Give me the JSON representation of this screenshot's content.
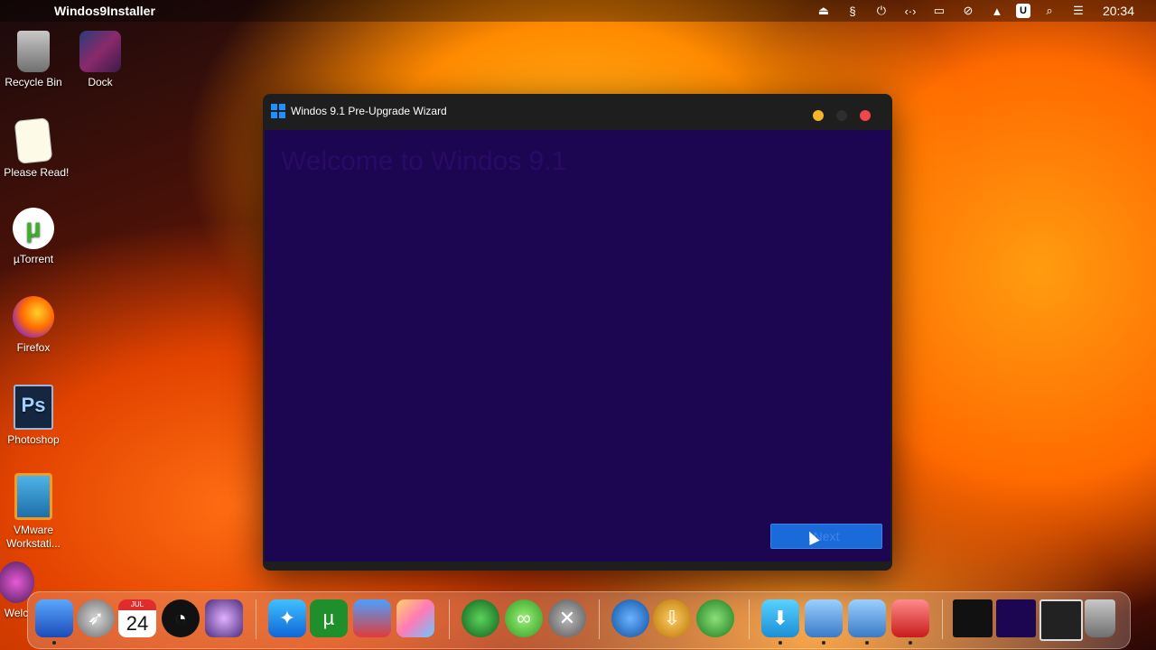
{
  "menubar": {
    "app_name": "Windos9Installer",
    "clock": "20:34",
    "status_icons": [
      "eject-icon",
      "script-icon",
      "power-icon",
      "code-icon",
      "display-icon",
      "wifi-off-icon",
      "upload-icon",
      "u-badge-icon",
      "search-icon",
      "control-center-icon"
    ],
    "u_badge": "U"
  },
  "desktop": {
    "icons": [
      {
        "label": "Recycle Bin",
        "icon": "recycle-bin-icon"
      },
      {
        "label": "Dock",
        "icon": "dock-icon"
      },
      {
        "label": "! Please Read!",
        "icon": "readme-note-icon"
      },
      {
        "label": "µTorrent",
        "icon": "utorrent-icon"
      },
      {
        "label": "Firefox",
        "icon": "firefox-icon"
      },
      {
        "label": "Photoshop",
        "icon": "photoshop-icon"
      },
      {
        "label": "VMware Workstati...",
        "icon": "vmware-icon"
      },
      {
        "label": "Welc",
        "icon": "welcome-icon"
      }
    ]
  },
  "window": {
    "title": "Windos 9.1 Pre-Upgrade Wizard",
    "heading": "Welcome to Windos 9.1",
    "subtitle": "",
    "next_label": "Next"
  },
  "dock": {
    "calendar_month": "JUL",
    "calendar_day": "24",
    "items": [
      "finder-icon",
      "launchpad-icon",
      "calendar-icon",
      "clock-icon",
      "macos-icon",
      "safari-icon",
      "utorrent-icon",
      "windows-app-icon",
      "photos-icon",
      "collabsysos-icon",
      "link-icon",
      "tools-icon",
      "www-icon",
      "download-app-icon",
      "network-icon",
      "downloads-folder-icon",
      "install-icon",
      "install2-icon",
      "image-viewer-icon",
      "terminal-thumb-icon",
      "window-thumb-icon",
      "window-thumb2-icon",
      "trash-icon"
    ],
    "colors": {
      "accent": "#1a6ad9",
      "window_bg": "#1c0551"
    }
  }
}
